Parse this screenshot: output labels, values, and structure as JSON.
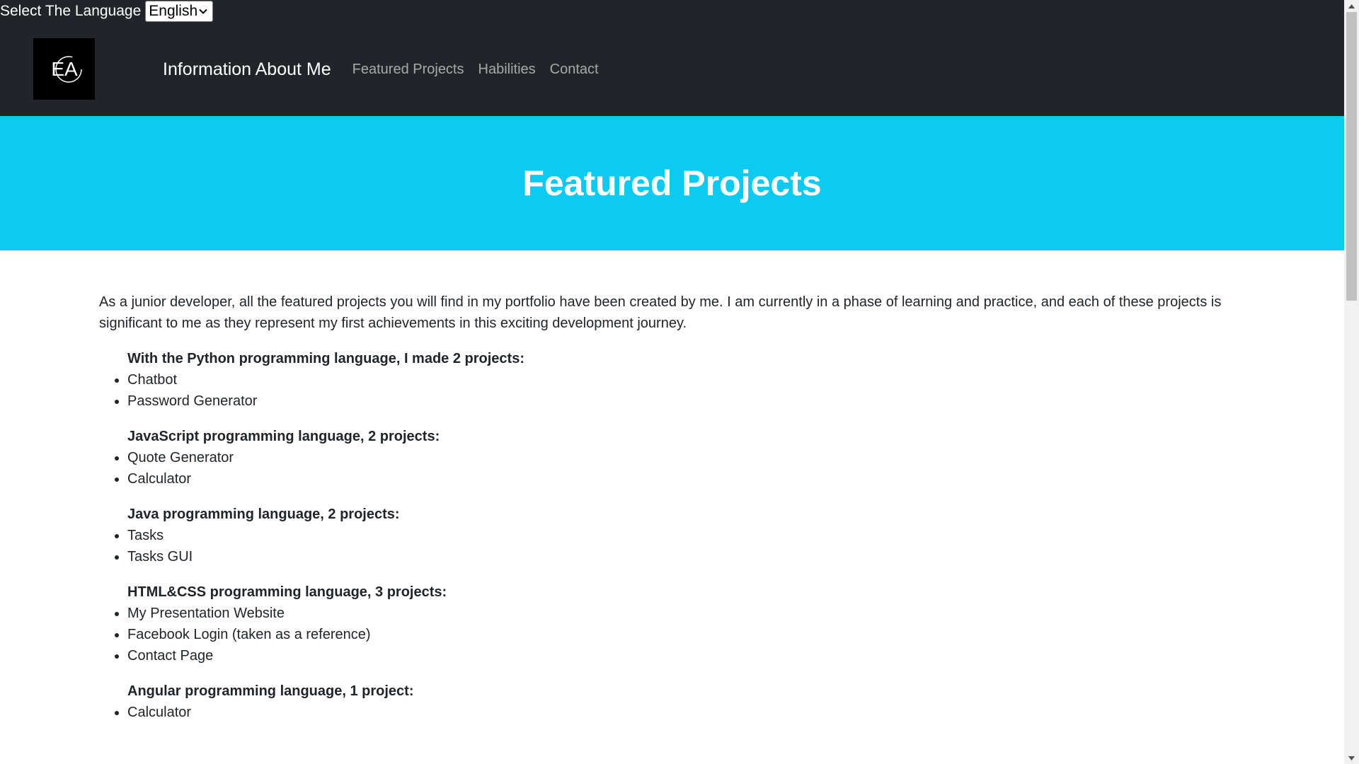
{
  "language": {
    "label": "Select The Language",
    "selected": "English"
  },
  "logo": {
    "text": "EA"
  },
  "nav": {
    "brand": "Information About Me",
    "links": [
      "Featured Projects",
      "Habilities",
      "Contact"
    ]
  },
  "hero": {
    "title": "Featured Projects"
  },
  "content": {
    "intro": "As a junior developer, all the featured projects you will find in my portfolio have been created by me. I am currently in a phase of learning and practice, and each of these projects is significant to me as they represent my first achievements in this exciting development journey.",
    "groups": [
      {
        "title": "With the Python programming language, I made 2 projects:",
        "items": [
          "Chatbot",
          "Password Generator"
        ]
      },
      {
        "title": "JavaScript programming language, 2 projects:",
        "items": [
          "Quote Generator",
          "Calculator"
        ]
      },
      {
        "title": "Java programming language, 2 projects:",
        "items": [
          "Tasks",
          "Tasks GUI"
        ]
      },
      {
        "title": "HTML&CSS programming language, 3 projects:",
        "items": [
          "My Presentation Website",
          "Facebook Login (taken as a reference)",
          "Contact Page"
        ]
      },
      {
        "title": "Angular programming language, 1 project:",
        "items": [
          "Calculator"
        ]
      }
    ]
  },
  "colors": {
    "header": "#212529",
    "hero": "#0dcaf0"
  }
}
